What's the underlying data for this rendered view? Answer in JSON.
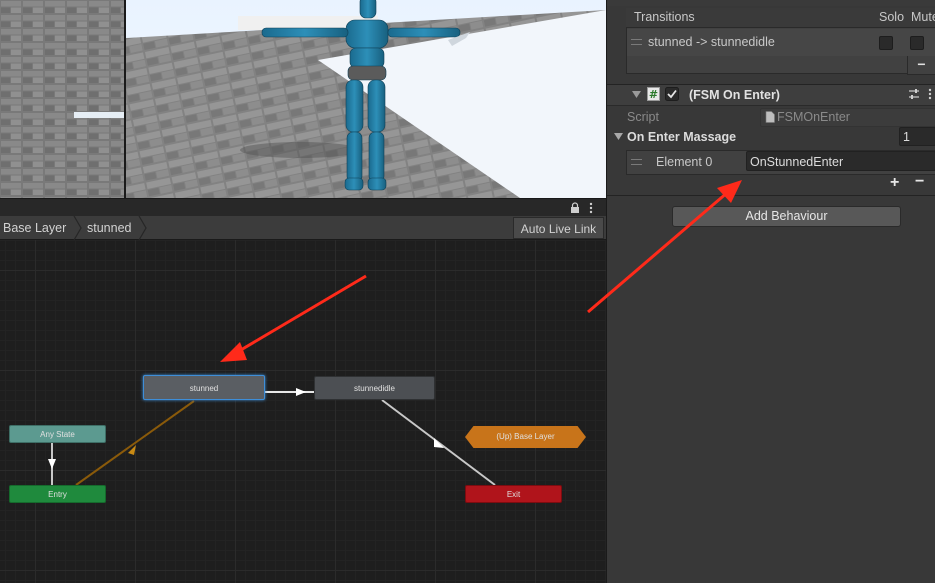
{
  "scene": {},
  "animator": {
    "breadcrumbs": [
      "Base Layer",
      "stunned"
    ],
    "auto_live_link": "Auto Live Link",
    "nodes": {
      "stunned": "stunned",
      "stunnedidle": "stunnedidle",
      "any_state": "Any State",
      "entry": "Entry",
      "exit": "Exit",
      "up_base_layer": "(Up) Base Layer"
    }
  },
  "inspector": {
    "transitions": {
      "header": "Transitions",
      "solo": "Solo",
      "mute": "Mute",
      "row": "stunned -> stunnedidle",
      "minus": "−"
    },
    "component": {
      "title": "(FSM On Enter)",
      "script_label": "Script",
      "script_value": "FSMOnEnter",
      "list_label": "On Enter Massage",
      "list_count": "1",
      "element_label": "Element 0",
      "element_value": "OnStunnedEnter",
      "plus": "+",
      "minus": "−"
    },
    "add_behaviour": "Add Behaviour"
  },
  "colors": {
    "selected_outline": "#3e8ed8",
    "entry": "#1f8a3d",
    "exit": "#b0141b",
    "any_state": "#5c9a90",
    "up_layer": "#c8741a",
    "annotation": "#ff2a1a"
  }
}
